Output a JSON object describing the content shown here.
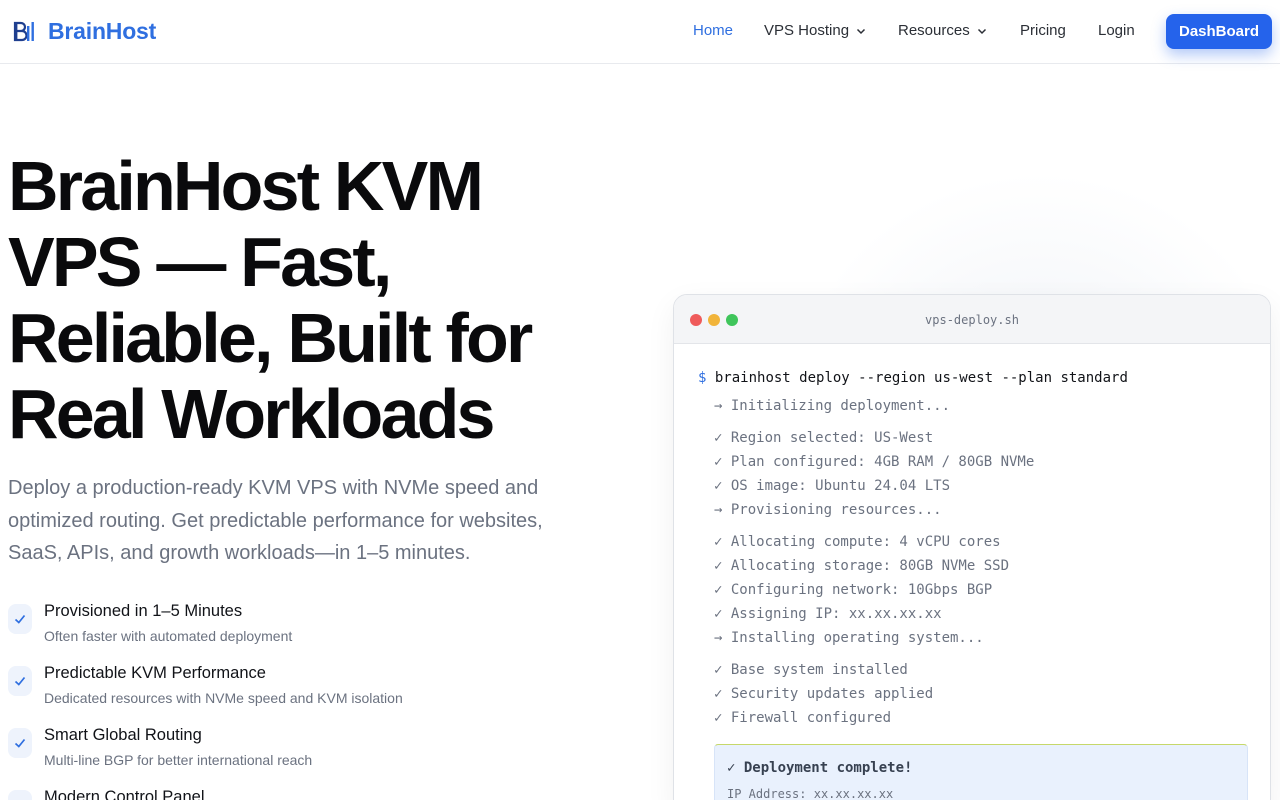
{
  "brand": {
    "name": "BrainHost",
    "logo_icon": "brainhost-logo-icon",
    "accent": "#2f6fe0"
  },
  "nav": {
    "items": [
      {
        "label": "Home",
        "active": true,
        "dropdown": false
      },
      {
        "label": "VPS Hosting",
        "active": false,
        "dropdown": true
      },
      {
        "label": "Resources",
        "active": false,
        "dropdown": true
      },
      {
        "label": "Pricing",
        "active": false,
        "dropdown": false
      },
      {
        "label": "Login",
        "active": false,
        "dropdown": false
      }
    ],
    "cta_label": "DashBoard",
    "cta_color": "#2563eb"
  },
  "hero": {
    "title_lines": [
      "BrainHost KVM",
      "VPS — Fast,",
      "Reliable, Built for",
      "Real Workloads"
    ],
    "subtitle": "Deploy a production-ready KVM VPS with NVMe speed and optimized routing. Get predictable performance for websites, SaaS, APIs, and growth workloads—in 1–5 minutes."
  },
  "features": [
    {
      "icon": "check-icon",
      "title": "Provisioned in 1–5 Minutes",
      "desc": "Often faster with automated deployment"
    },
    {
      "icon": "check-icon",
      "title": "Predictable KVM Performance",
      "desc": "Dedicated resources with NVMe speed and KVM isolation"
    },
    {
      "icon": "check-icon",
      "title": "Smart Global Routing",
      "desc": "Multi-line BGP for better international reach"
    },
    {
      "icon": "check-icon",
      "title": "Modern Control Panel",
      "desc": ""
    }
  ],
  "terminal": {
    "title": "vps-deploy.sh",
    "prompt": "$",
    "command": "brainhost deploy --region us-west --plan standard",
    "lines": [
      "→ Initializing deployment...",
      "✓ Region selected: US-West",
      "✓ Plan configured: 4GB RAM / 80GB NVMe",
      "✓ OS image: Ubuntu 24.04 LTS",
      "→ Provisioning resources...",
      "✓ Allocating compute: 4 vCPU cores",
      "✓ Allocating storage: 80GB NVMe SSD",
      "✓ Configuring network: 10Gbps BGP",
      "✓ Assigning IP: xx.xx.xx.xx",
      "→ Installing operating system...",
      "✓ Base system installed",
      "✓ Security updates applied",
      "✓ Firewall configured"
    ],
    "done_title": "✓ Deployment complete!",
    "ip_label": "IP Address:",
    "ip_value": "xx.xx.xx.xx"
  }
}
